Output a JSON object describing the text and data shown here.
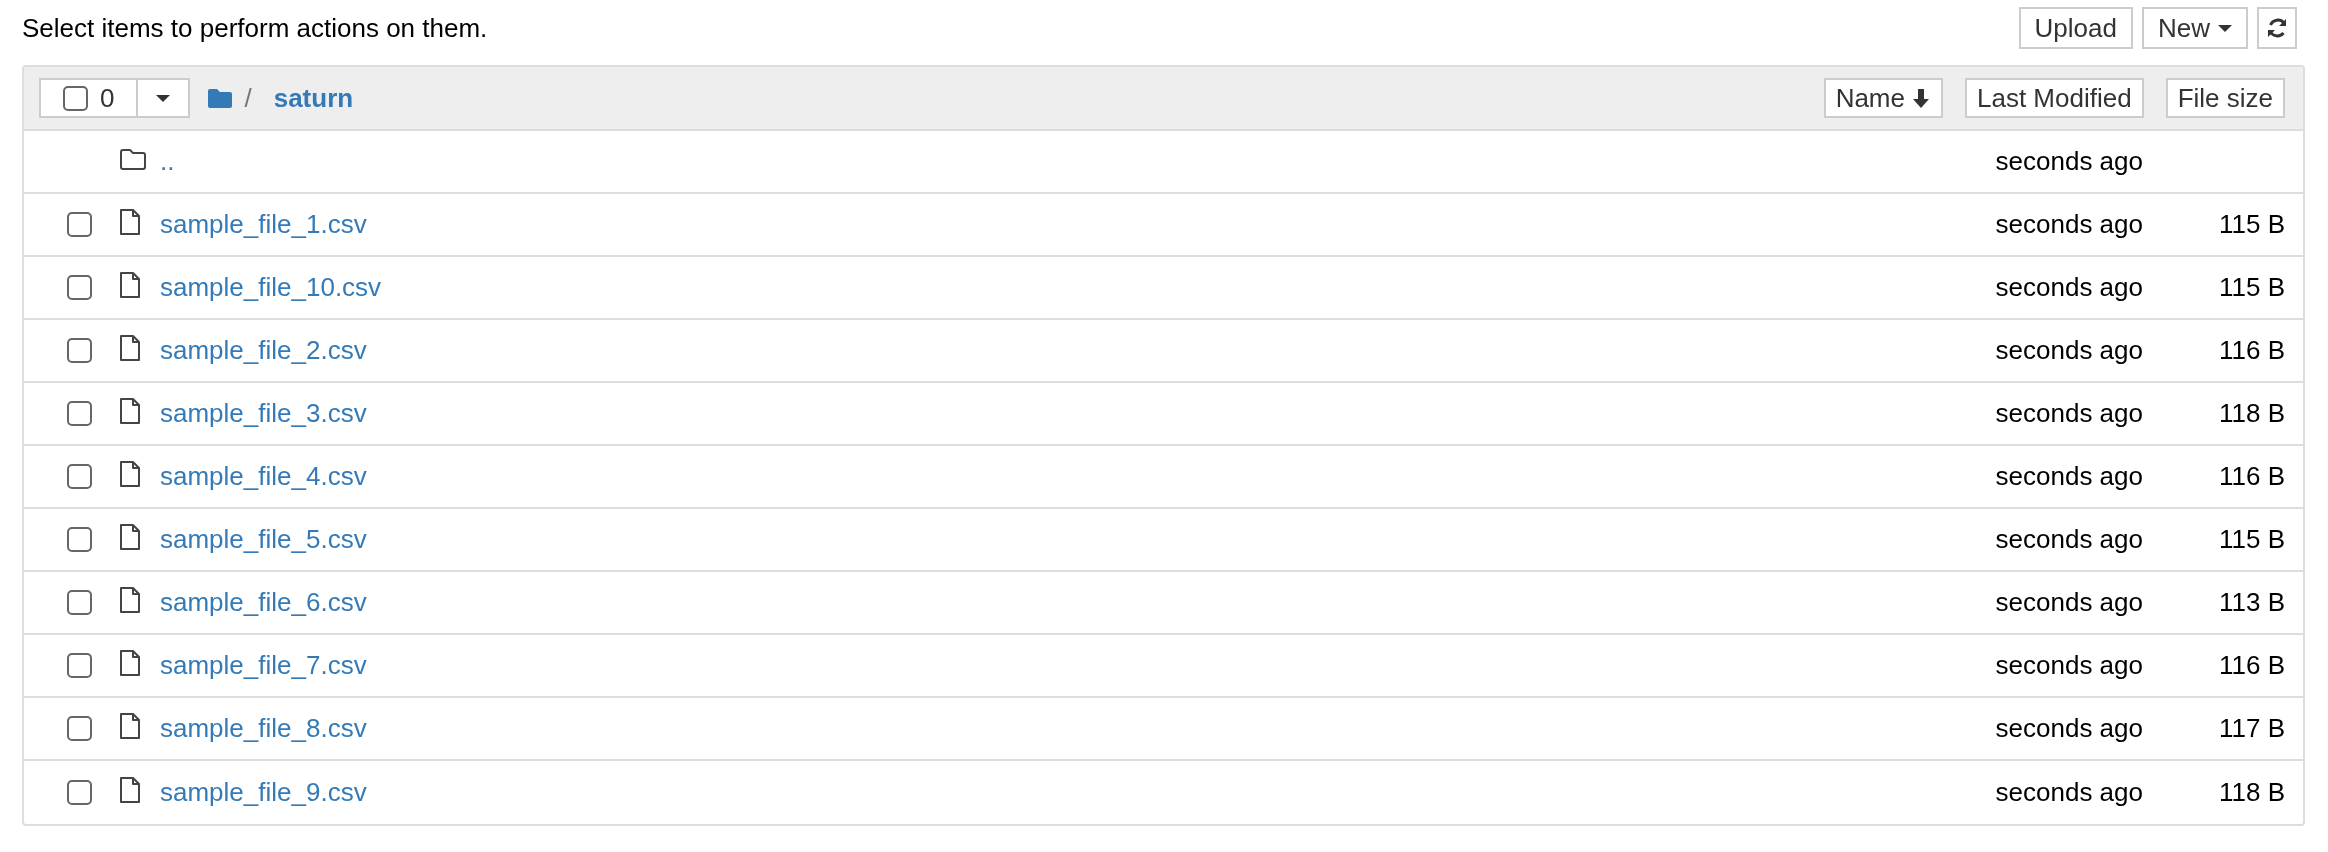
{
  "instructions": "Select items to perform actions on them.",
  "toolbar": {
    "buttons": [
      {
        "kind": "text",
        "label": "Upload"
      },
      {
        "kind": "dropdown",
        "label": "New"
      },
      {
        "kind": "refresh"
      }
    ]
  },
  "header": {
    "selected_count": "0",
    "select_all_checked": false,
    "breadcrumb": {
      "separator": "/",
      "folder": "saturn"
    },
    "sort_buttons": [
      {
        "label": "Name",
        "sorted": true
      },
      {
        "label": "Last Modified",
        "sorted": false
      },
      {
        "label": "File size",
        "sorted": false
      }
    ]
  },
  "rows": [
    {
      "kind": "parent",
      "name": "..",
      "modified": "seconds ago"
    },
    {
      "kind": "file",
      "name": "sample_file_1.csv",
      "modified": "seconds ago",
      "size": "115 B",
      "checked": false
    },
    {
      "kind": "file",
      "name": "sample_file_10.csv",
      "modified": "seconds ago",
      "size": "115 B",
      "checked": false
    },
    {
      "kind": "file",
      "name": "sample_file_2.csv",
      "modified": "seconds ago",
      "size": "116 B",
      "checked": false
    },
    {
      "kind": "file",
      "name": "sample_file_3.csv",
      "modified": "seconds ago",
      "size": "118 B",
      "checked": false
    },
    {
      "kind": "file",
      "name": "sample_file_4.csv",
      "modified": "seconds ago",
      "size": "116 B",
      "checked": false
    },
    {
      "kind": "file",
      "name": "sample_file_5.csv",
      "modified": "seconds ago",
      "size": "115 B",
      "checked": false
    },
    {
      "kind": "file",
      "name": "sample_file_6.csv",
      "modified": "seconds ago",
      "size": "113 B",
      "checked": false
    },
    {
      "kind": "file",
      "name": "sample_file_7.csv",
      "modified": "seconds ago",
      "size": "116 B",
      "checked": false
    },
    {
      "kind": "file",
      "name": "sample_file_8.csv",
      "modified": "seconds ago",
      "size": "117 B",
      "checked": false
    },
    {
      "kind": "file",
      "name": "sample_file_9.csv",
      "modified": "seconds ago",
      "size": "118 B",
      "checked": false
    }
  ]
}
